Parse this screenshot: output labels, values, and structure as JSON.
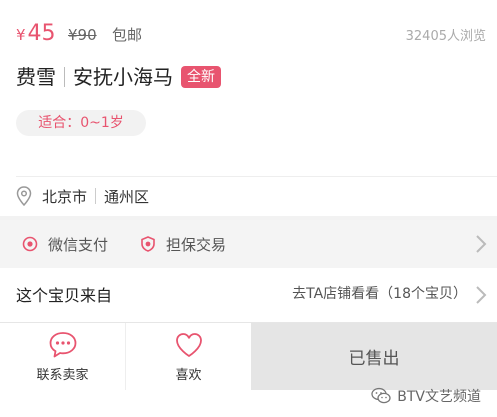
{
  "price": {
    "currency": "¥",
    "current": "45",
    "original": "¥90",
    "shipping": "包邮",
    "views": "32405人浏览"
  },
  "title": {
    "part1": "费雪",
    "part2": "安抚小海马",
    "badge": "全新"
  },
  "age": {
    "label": "适合：0~1岁"
  },
  "location": {
    "city": "北京市",
    "district": "通州区"
  },
  "payment": {
    "wechat": "微信支付",
    "guarantee": "担保交易"
  },
  "shop": {
    "title": "这个宝贝来自",
    "link": "去TA店铺看看（18个宝贝）"
  },
  "bottom": {
    "contact": "联系卖家",
    "like": "喜欢",
    "sold_out": "已售出"
  },
  "watermark": {
    "text": "BTV文艺频道"
  },
  "colors": {
    "accent": "#e8546f",
    "muted": "#aaaaaa",
    "panel": "#f4f4f4"
  }
}
